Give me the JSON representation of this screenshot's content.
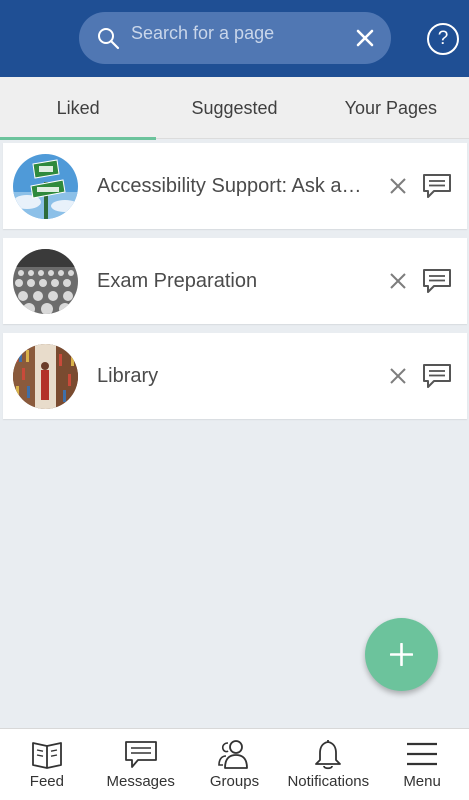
{
  "header": {
    "search_placeholder": "Search for a page",
    "help_label": "?"
  },
  "tabs": [
    {
      "label": "Liked",
      "active": true
    },
    {
      "label": "Suggested",
      "active": false
    },
    {
      "label": "Your Pages",
      "active": false
    }
  ],
  "pages": [
    {
      "title": "Accessibility Support: Ask a…",
      "avatar": "help-support-sign-photo"
    },
    {
      "title": "Exam Preparation",
      "avatar": "exam-hall-photo"
    },
    {
      "title": "Library",
      "avatar": "library-shelves-photo"
    }
  ],
  "bottom_nav": [
    {
      "label": "Feed",
      "icon": "book-icon"
    },
    {
      "label": "Messages",
      "icon": "message-icon"
    },
    {
      "label": "Groups",
      "icon": "groups-icon"
    },
    {
      "label": "Notifications",
      "icon": "bell-icon"
    },
    {
      "label": "Menu",
      "icon": "hamburger-icon"
    }
  ],
  "colors": {
    "header": "#1f4f94",
    "accent": "#6cc39c",
    "background": "#e9edf1"
  }
}
